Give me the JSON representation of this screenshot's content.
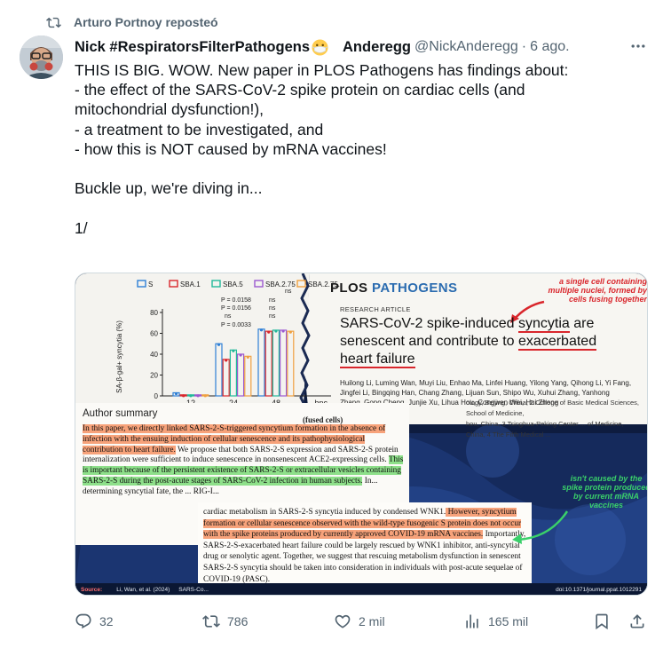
{
  "repost": {
    "text": "Arturo Portnoy reposteó"
  },
  "author": {
    "name": "Nick #RespiratorsFilterPathogens",
    "name2": "Anderegg",
    "handle": "@NickAnderegg",
    "dot": "·",
    "time": "6 ago."
  },
  "tweet": {
    "lines": [
      "THIS IS BIG. WOW. New paper in PLOS Pathogens has findings about:",
      "- the effect of the SARS-CoV-2 spike protein on cardiac cells (and",
      "mitochondrial dysfunction!),",
      "- a treatment to be investigated, and",
      "- how this is NOT caused by mRNA vaccines!",
      "",
      "Buckle up, we're diving in...",
      "",
      "1/"
    ]
  },
  "media": {
    "journal_left": "PLOS",
    "journal_right": "PATHOGENS",
    "red_note": "a single cell containing multiple nuclei, formed by cells fusing together",
    "article_type": "RESEARCH ARTICLE",
    "title_a": "SARS-CoV-2 spike-induced",
    "title_b": "syncytia",
    "title_c": "are",
    "title_d": "senescent and contribute to",
    "title_e": "exacerbated",
    "title_f": "heart failure",
    "authors": "Huilong Li, Luming Wan, Muyi Liu, Enhao Ma, Linfei Huang, Yilong Yang, Qihong Li, Yi Fang, Jingfei Li, Bingqing Han, Chang Zhang, Lijuan Sun, Shipo Wu, Xuhui Zhang, Yanhong Zhang, Gong Cheng, Junjie Xu, Lihua Hou, Congwen Wei, Hui Zhong",
    "affil_1": "ology, Beijing, China, 2 College of Basic Medical Sciences, School of Medicine,",
    "affil_2": "hou, China, 3 Tsinghua-Peking Center ... of Medicine,",
    "affil_3": "China, 4 The Fifth Medical ...",
    "summary_heading": "Author summary",
    "fused_cells": "(fused cells)",
    "summary_p1": "In this paper, we directly linked SARS-2-S-triggered syncytium formation in the absence of infection with the ensuing induction of cellular senescence and its pathophysiological contribution to heart failure.",
    "summary_p2": " We propose that both SARS-2-S expression and SARS-2-S protein internalization were sufficient to induce senescence in nonsenescent ACE2-expressing cells. ",
    "summary_p3": "This is important because of the persistent existence of SARS-2-S or extracellular vesicles containing SARS-2-S during the post-acute stages of SARS-CoV-2 infection in human subjects.",
    "summary_p4": " In... determining syncytial fate, the ... RIG-I...",
    "excerpt_a": "cardiac metabolism in SARS-2-S syncytia induced by condensed WNK1.",
    "excerpt_b": " However, syncytium formation or cellular senescence observed with the wild-type fusogenic S protein does not occur with the spike proteins produced by currently approved COVID-19 mRNA vaccines.",
    "excerpt_c": " Importantly, SARS-2-S-exacerbated heart failure could be largely rescued by WNK1 inhibitor, anti-syncytial drug or senolytic agent. Together, we suggest that rescuing metabolism dysfunction in senescent SARS-2-S syncytia should be taken into consideration in individuals with post-acute sequelae of COVID-19 (PASC).",
    "green_note": "isn't caused by the spike protein produced by current mRNA vaccines",
    "source_label": "Source:",
    "source_text": "Li, Wan, et al. (2024)",
    "source_title": "SARS-Co...",
    "doi": "doi:10.1371/journal.ppat.1012291"
  },
  "chart_data": {
    "type": "bar",
    "ylabel": "SA-β-gal+ syncytia (%)",
    "xlabel": "hpc",
    "categories": [
      "12",
      "24",
      "48"
    ],
    "ylim": [
      0,
      80
    ],
    "yticks": [
      "0",
      "20",
      "40",
      "60",
      "80"
    ],
    "legend_label_s": "S",
    "legend": [
      "S",
      "SBA.1",
      "SBA.5",
      "SBA.2.75",
      "SBA.2.75.2"
    ],
    "colors": [
      "#2e7fd6",
      "#d9262c",
      "#22b89a",
      "#9b59d0",
      "#f0a040"
    ],
    "series": [
      {
        "name": "S",
        "values": [
          3,
          50,
          64
        ]
      },
      {
        "name": "SBA.1",
        "values": [
          1,
          35,
          62
        ]
      },
      {
        "name": "SBA.5",
        "values": [
          1,
          44,
          63
        ]
      },
      {
        "name": "SBA.2.75",
        "values": [
          1,
          40,
          63
        ]
      },
      {
        "name": "SBA.2.75.2",
        "values": [
          1,
          38,
          62
        ]
      }
    ],
    "annotations": [
      "P = 0.0158",
      "P = 0.0156",
      "ns",
      "P = 0.0033",
      "ns",
      "ns",
      "ns",
      "ns"
    ]
  },
  "stats": {
    "replies": "32",
    "reposts": "786",
    "likes": "2 mil",
    "views": "165 mil"
  }
}
